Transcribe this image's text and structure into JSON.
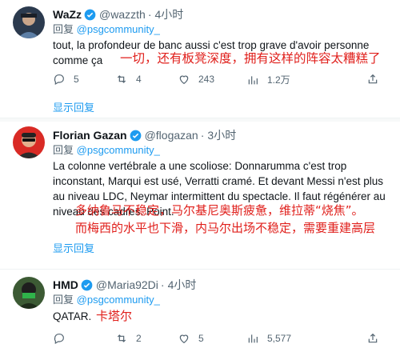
{
  "tweets": [
    {
      "name": "WaZz",
      "handle": "@wazzth",
      "time": "4小时",
      "replying_prefix": "回复",
      "replying_to": "@psgcommunity_",
      "text": "tout, la profondeur de banc aussi c'est trop grave d'avoir personne comme ça",
      "translation": "一切，还有板凳深度，拥有这样的阵容太糟糕了",
      "replies": "5",
      "retweets": "4",
      "likes": "243",
      "views": "1.2万",
      "show_replies": "显示回复"
    },
    {
      "name": "Florian Gazan",
      "handle": "@flogazan",
      "time": "3小时",
      "replying_prefix": "回复",
      "replying_to": "@psgcommunity_",
      "text": "La colonne vertébrale a une scoliose: Donnarumma c'est trop inconstant, Marqui est usé, Verratti cramé. Et devant Messi n'est plus au niveau LDC, Neymar intermittent du spectacle. Il faut régénérer au niveau des cadres. Point.",
      "translation_line1": "多纳鲁马不稳定，马尔基尼奥斯疲惫，维拉蒂“烧焦”。",
      "translation_line2": "而梅西的水平也下滑，内马尔出场不稳定，需要重建高层",
      "show_replies": "显示回复"
    },
    {
      "name": "HMD",
      "handle": "@Maria92Di",
      "time": "4小时",
      "replying_prefix": "回复",
      "replying_to": "@psgcommunity_",
      "text": "QATAR.",
      "translation": "卡塔尔",
      "replies": "",
      "retweets": "2",
      "likes": "5",
      "views": "5,577"
    }
  ],
  "icons": {
    "verified": "verified-badge-icon",
    "reply": "reply-icon",
    "retweet": "retweet-icon",
    "like": "like-icon",
    "views": "views-icon",
    "share": "share-icon"
  },
  "colors": {
    "accent": "#1d9bf0",
    "overlay_text": "#e0201c",
    "muted": "#536471"
  }
}
